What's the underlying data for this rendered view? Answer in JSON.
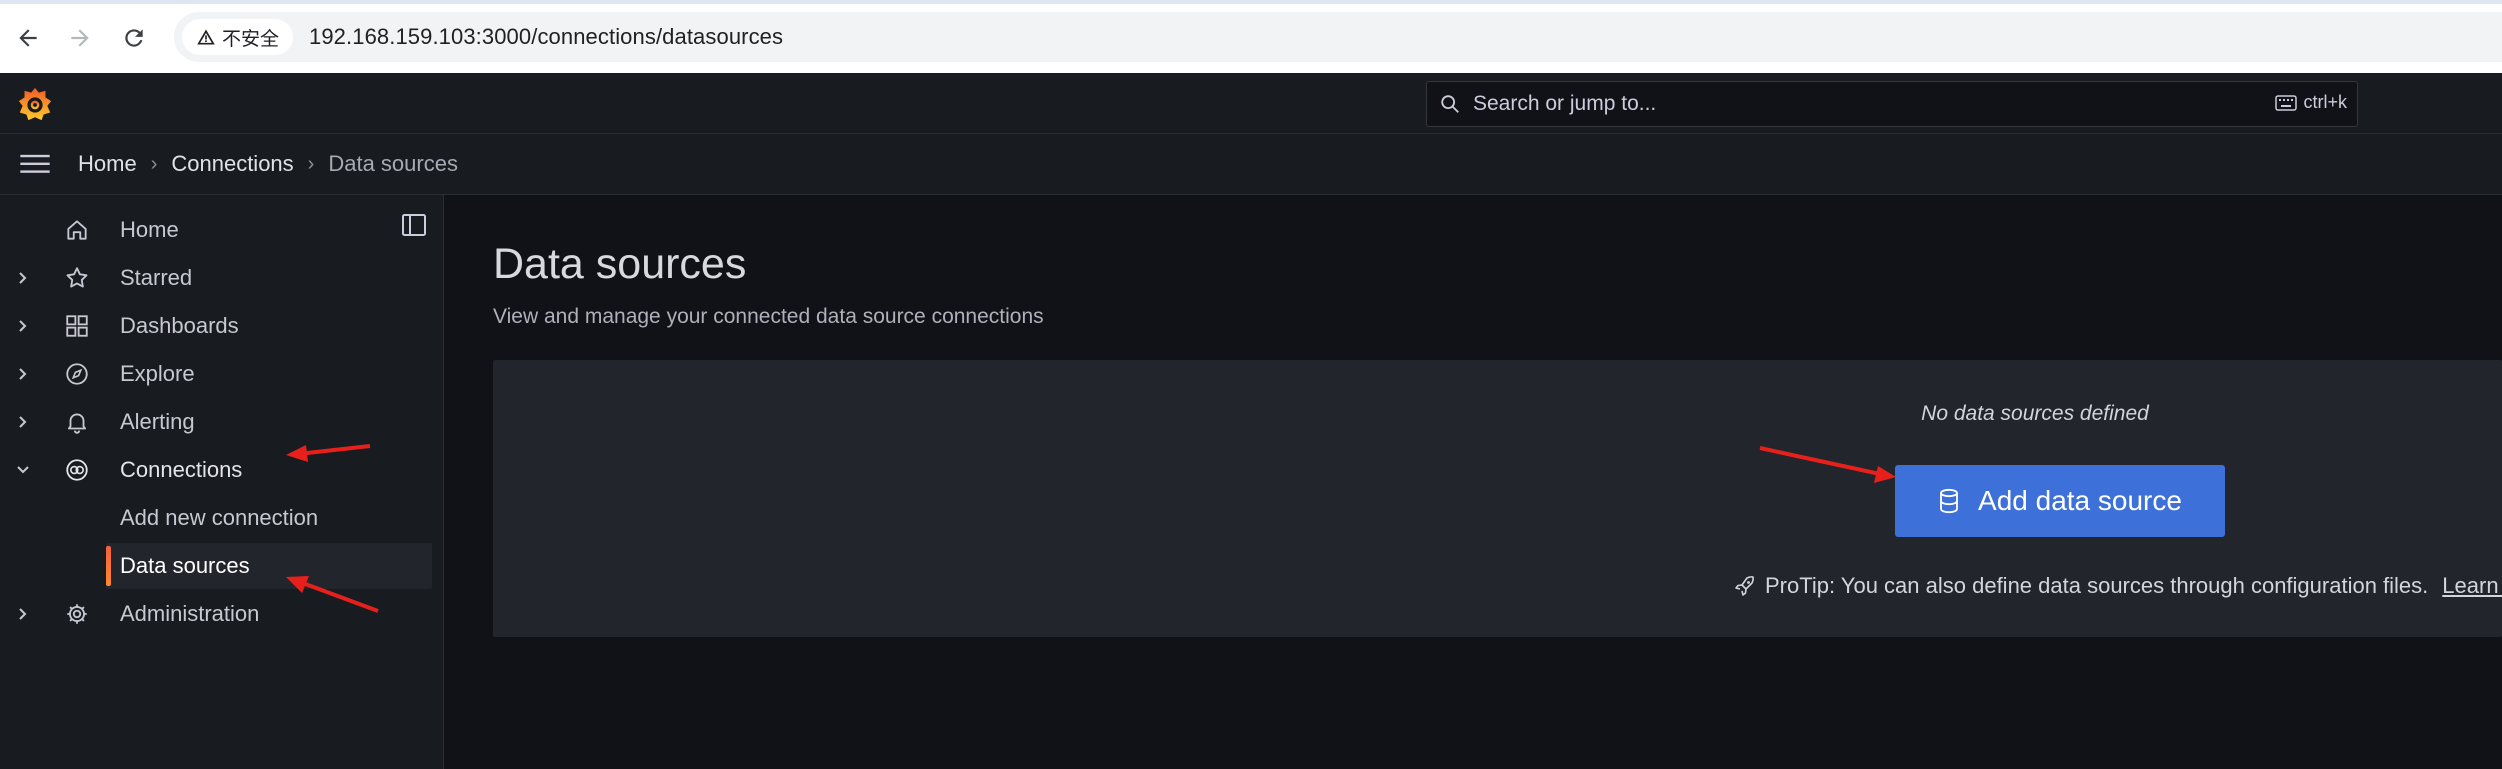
{
  "browser": {
    "security_label": "不安全",
    "url": "192.168.159.103:3000/connections/datasources"
  },
  "topbar": {
    "search_placeholder": "Search or jump to...",
    "shortcut": "ctrl+k"
  },
  "breadcrumb": {
    "items": [
      "Home",
      "Connections",
      "Data sources"
    ]
  },
  "sidebar": {
    "items": [
      {
        "label": "Home",
        "icon": "home-icon"
      },
      {
        "label": "Starred",
        "icon": "star-icon"
      },
      {
        "label": "Dashboards",
        "icon": "apps-icon"
      },
      {
        "label": "Explore",
        "icon": "compass-icon"
      },
      {
        "label": "Alerting",
        "icon": "bell-icon"
      },
      {
        "label": "Connections",
        "icon": "connections-icon"
      },
      {
        "label": "Administration",
        "icon": "cog-icon"
      }
    ],
    "subitems": [
      {
        "label": "Add new connection"
      },
      {
        "label": "Data sources"
      }
    ]
  },
  "main": {
    "title": "Data sources",
    "subtitle": "View and manage your connected data source connections",
    "empty_text": "No data sources defined",
    "add_button_label": "Add data source",
    "protip_text": "ProTip: You can also define data sources through configuration files.",
    "learn_more_label": "Learn m"
  },
  "colors": {
    "accent_blue": "#3d71d9",
    "active_indicator": "#f55f3e",
    "annotation_red": "#e8201c"
  }
}
